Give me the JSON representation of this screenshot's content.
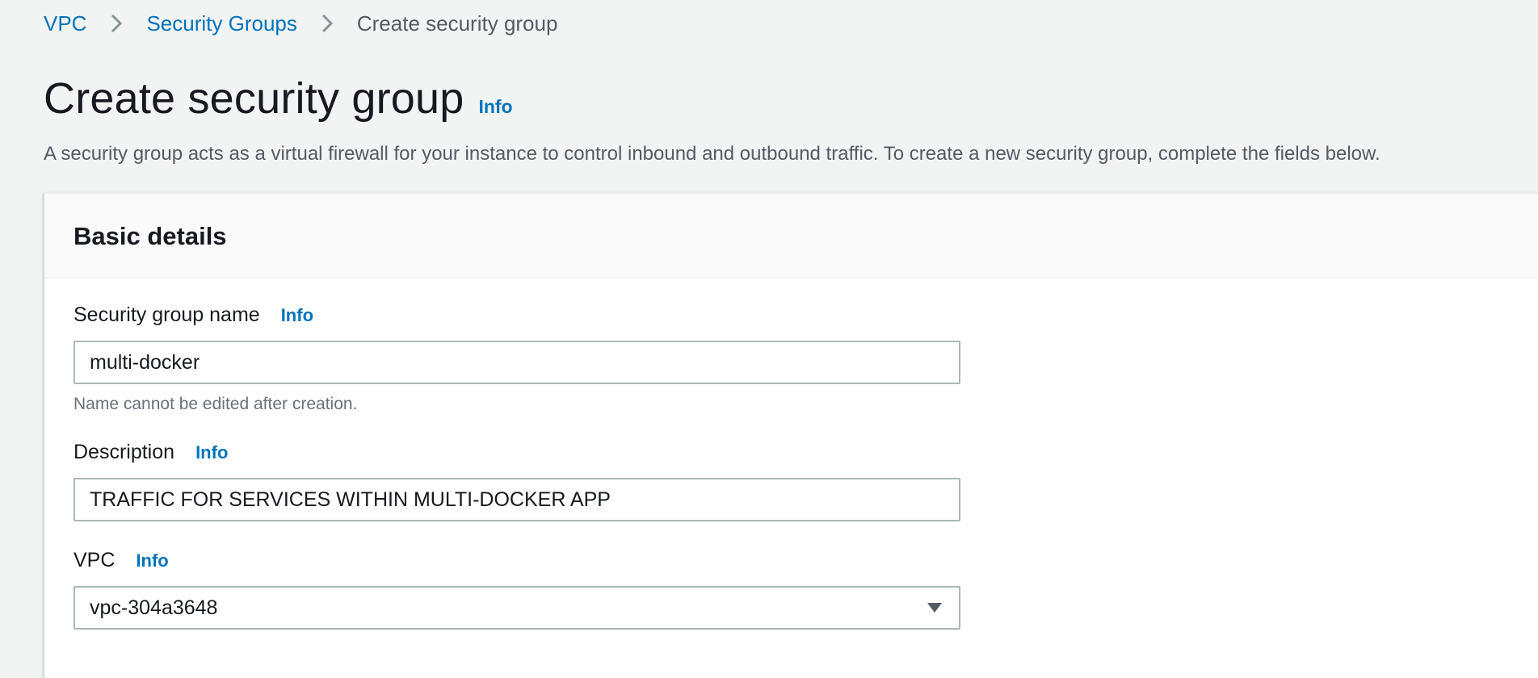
{
  "breadcrumb": {
    "items": [
      {
        "label": "VPC"
      },
      {
        "label": "Security Groups"
      },
      {
        "label": "Create security group"
      }
    ]
  },
  "page": {
    "title": "Create security group",
    "info_label": "Info",
    "description": "A security group acts as a virtual firewall for your instance to control inbound and outbound traffic. To create a new security group, complete the fields below."
  },
  "basic_details": {
    "title": "Basic details",
    "name_field": {
      "label": "Security group name",
      "info_label": "Info",
      "value": "multi-docker",
      "constraint": "Name cannot be edited after creation."
    },
    "description_field": {
      "label": "Description",
      "info_label": "Info",
      "value": "TRAFFIC FOR SERVICES WITHIN MULTI-DOCKER APP"
    },
    "vpc_field": {
      "label": "VPC",
      "info_label": "Info",
      "selected": "vpc-304a3648"
    }
  },
  "icons": {
    "breadcrumb_separator": "chevron-right-icon",
    "select_caret": "caret-down-icon"
  },
  "colors": {
    "link": "#0073bb",
    "text": "#16191f",
    "muted_text": "#545b64",
    "background": "#f2f3f3",
    "input_border": "#aab7b8"
  }
}
